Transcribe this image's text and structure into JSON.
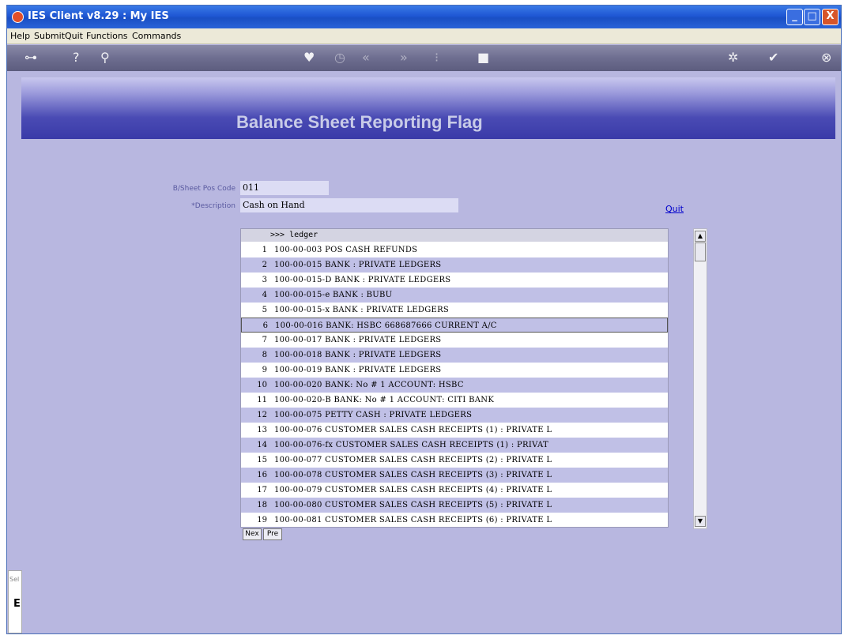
{
  "window": {
    "title": "IES Client v8.29 : My IES",
    "controls": {
      "minimize": "_",
      "maximize": "□",
      "close": "X"
    }
  },
  "menu": [
    "Help",
    "Submit",
    "Quit",
    "Functions",
    "Commands"
  ],
  "toolbar_icons": [
    "key-icon",
    "help-icon",
    "search-icon",
    "heart-icon",
    "clock-icon",
    "rewind-icon",
    "fast-forward-icon",
    "list-icon",
    "stop-icon",
    "gear-icon",
    "check-icon",
    "cancel-icon"
  ],
  "banner": {
    "title": "Balance Sheet Reporting Flag"
  },
  "form": {
    "pos_code_label": "B/Sheet Pos Code",
    "pos_code_value": "011",
    "description_label": "*Description",
    "description_value": "Cash on Hand"
  },
  "quit_link": "Quit",
  "grid": {
    "header": ">>> ledger",
    "selected_row": 6,
    "rows": [
      {
        "num": "1",
        "text": "100-00-003 POS CASH REFUNDS"
      },
      {
        "num": "2",
        "text": "100-00-015 BANK : PRIVATE LEDGERS"
      },
      {
        "num": "3",
        "text": "100-00-015-D BANK : PRIVATE LEDGERS"
      },
      {
        "num": "4",
        "text": "100-00-015-e BANK : BUBU"
      },
      {
        "num": "5",
        "text": "100-00-015-x BANK : PRIVATE LEDGERS"
      },
      {
        "num": "6",
        "text": "100-00-016 BANK: HSBC 668687666 CURRENT A/C"
      },
      {
        "num": "7",
        "text": "100-00-017 BANK : PRIVATE LEDGERS"
      },
      {
        "num": "8",
        "text": "100-00-018 BANK : PRIVATE LEDGERS"
      },
      {
        "num": "9",
        "text": "100-00-019 BANK : PRIVATE LEDGERS"
      },
      {
        "num": "10",
        "text": "100-00-020 BANK: No # 1 ACCOUNT: HSBC"
      },
      {
        "num": "11",
        "text": "100-00-020-B BANK: No # 1 ACCOUNT: CITI BANK"
      },
      {
        "num": "12",
        "text": "100-00-075 PETTY CASH : PRIVATE LEDGERS"
      },
      {
        "num": "13",
        "text": "100-00-076 CUSTOMER SALES CASH RECEIPTS (1) : PRIVATE L"
      },
      {
        "num": "14",
        "text": "100-00-076-fx CUSTOMER SALES CASH RECEIPTS (1) : PRIVAT"
      },
      {
        "num": "15",
        "text": "100-00-077 CUSTOMER SALES CASH RECEIPTS (2) : PRIVATE L"
      },
      {
        "num": "16",
        "text": "100-00-078 CUSTOMER SALES CASH RECEIPTS (3) : PRIVATE L"
      },
      {
        "num": "17",
        "text": "100-00-079 CUSTOMER SALES CASH RECEIPTS (4) : PRIVATE L"
      },
      {
        "num": "18",
        "text": "100-00-080 CUSTOMER SALES CASH RECEIPTS (5) : PRIVATE L"
      },
      {
        "num": "19",
        "text": "100-00-081 CUSTOMER SALES CASH RECEIPTS (6) : PRIVATE L"
      }
    ]
  },
  "pager": {
    "next": "Nex",
    "prev": "Pre"
  },
  "side_stub": {
    "text": "Sel",
    "icon": "E"
  }
}
